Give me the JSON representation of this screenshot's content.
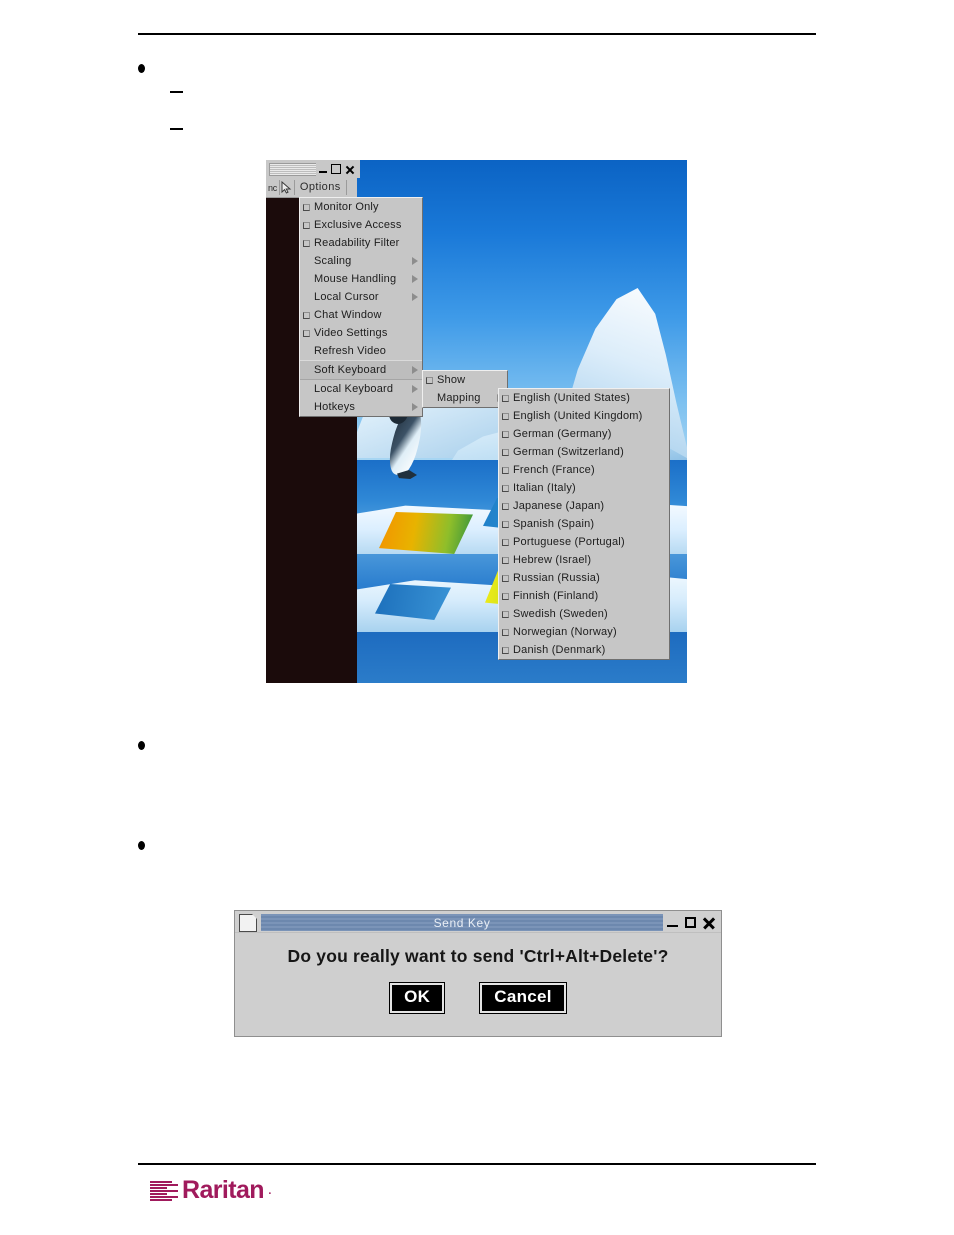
{
  "document": {
    "bullets": [
      "",
      "",
      ""
    ],
    "sub_dashes": [
      "",
      ""
    ],
    "footer_logo": {
      "wordmark": "Raritan",
      "trademark_dot": ".",
      "color": "#a01a5c"
    }
  },
  "kvm_window": {
    "menubar": {
      "truncated_label": "nc",
      "cursor_icon": "pointer-cursor-icon",
      "options_label": "Options"
    },
    "window_buttons": {
      "minimize": "minimize-icon",
      "maximize": "maximize-icon",
      "close": "close-icon"
    },
    "options_menu": [
      {
        "label": "Monitor Only",
        "checkbox": true,
        "submenu": false,
        "highlighted": false
      },
      {
        "label": "Exclusive Access",
        "checkbox": true,
        "submenu": false,
        "highlighted": false
      },
      {
        "label": "Readability Filter",
        "checkbox": true,
        "submenu": false,
        "highlighted": false
      },
      {
        "label": "Scaling",
        "checkbox": false,
        "submenu": true,
        "highlighted": false
      },
      {
        "label": "Mouse Handling",
        "checkbox": false,
        "submenu": true,
        "highlighted": false
      },
      {
        "label": "Local Cursor",
        "checkbox": false,
        "submenu": true,
        "highlighted": false
      },
      {
        "label": "Chat Window",
        "checkbox": true,
        "submenu": false,
        "highlighted": false
      },
      {
        "label": "Video Settings",
        "checkbox": true,
        "submenu": false,
        "highlighted": false
      },
      {
        "label": "Refresh Video",
        "checkbox": false,
        "submenu": false,
        "highlighted": false
      },
      {
        "label": "Soft Keyboard",
        "checkbox": false,
        "submenu": true,
        "highlighted": true
      },
      {
        "label": "Local Keyboard",
        "checkbox": false,
        "submenu": true,
        "highlighted": false
      },
      {
        "label": "Hotkeys",
        "checkbox": false,
        "submenu": true,
        "highlighted": false
      }
    ],
    "soft_keyboard_submenu": [
      {
        "label": "Show",
        "checkbox": true,
        "submenu": false
      },
      {
        "label": "Mapping",
        "checkbox": false,
        "submenu": true
      }
    ],
    "mapping_languages": [
      {
        "label": "English (United States)",
        "checkbox": true
      },
      {
        "label": "English (United Kingdom)",
        "checkbox": true
      },
      {
        "label": "German (Germany)",
        "checkbox": true
      },
      {
        "label": "German (Switzerland)",
        "checkbox": true
      },
      {
        "label": "French (France)",
        "checkbox": true
      },
      {
        "label": "Italian (Italy)",
        "checkbox": true
      },
      {
        "label": "Japanese (Japan)",
        "checkbox": true
      },
      {
        "label": "Spanish (Spain)",
        "checkbox": true
      },
      {
        "label": "Portuguese (Portugal)",
        "checkbox": true
      },
      {
        "label": "Hebrew (Israel)",
        "checkbox": true
      },
      {
        "label": "Russian (Russia)",
        "checkbox": true
      },
      {
        "label": "Finnish (Finland)",
        "checkbox": true
      },
      {
        "label": "Swedish (Sweden)",
        "checkbox": true
      },
      {
        "label": "Norwegian (Norway)",
        "checkbox": true
      },
      {
        "label": "Danish (Denmark)",
        "checkbox": true
      }
    ]
  },
  "send_key_dialog": {
    "title": "Send Key",
    "message": "Do you really want to send 'Ctrl+Alt+Delete'?",
    "ok_label": "OK",
    "cancel_label": "Cancel",
    "window_buttons": {
      "minimize": "minimize-icon",
      "maximize": "maximize-icon",
      "close": "close-icon"
    },
    "titlebar_color": "#728cb0"
  }
}
